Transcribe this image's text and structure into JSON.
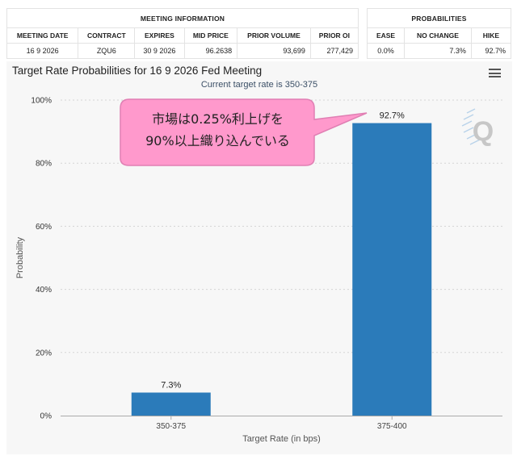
{
  "meeting_info": {
    "group_title": "MEETING INFORMATION",
    "columns": [
      "MEETING DATE",
      "CONTRACT",
      "EXPIRES",
      "MID PRICE",
      "PRIOR VOLUME",
      "PRIOR OI"
    ],
    "row": [
      "16 9 2026",
      "ZQU6",
      "30 9 2026",
      "96.2638",
      "93,699",
      "277,429"
    ]
  },
  "probabilities": {
    "group_title": "PROBABILITIES",
    "columns": [
      "EASE",
      "NO CHANGE",
      "HIKE"
    ],
    "row": [
      "0.0%",
      "7.3%",
      "92.7%"
    ]
  },
  "chart_header": {
    "title": "Target Rate Probabilities for 16 9 2026 Fed Meeting",
    "subtitle": "Current target rate is 350-375",
    "watermark": "Q"
  },
  "annotation": {
    "line1": "市場は0.25%利上げを",
    "line2": "90%以上織り込んでいる"
  },
  "colors": {
    "bar": "#2b7bba",
    "callout_fill": "#ff99cc",
    "callout_border": "#e07fb3",
    "grid": "#d5d5d5",
    "panel": "#f7f7f7"
  },
  "chart_data": {
    "type": "bar",
    "categories": [
      "350-375",
      "375-400"
    ],
    "values": [
      7.3,
      92.7
    ],
    "data_labels": [
      "7.3%",
      "92.7%"
    ],
    "title": "Target Rate Probabilities for 16 9 2026 Fed Meeting",
    "subtitle": "Current target rate is 350-375",
    "xlabel": "Target Rate (in bps)",
    "ylabel": "Probability",
    "ylim": [
      0,
      100
    ],
    "yticks": [
      0,
      20,
      40,
      60,
      80,
      100
    ],
    "ytick_labels": [
      "0%",
      "20%",
      "40%",
      "60%",
      "80%",
      "100%"
    ],
    "grid": true
  }
}
